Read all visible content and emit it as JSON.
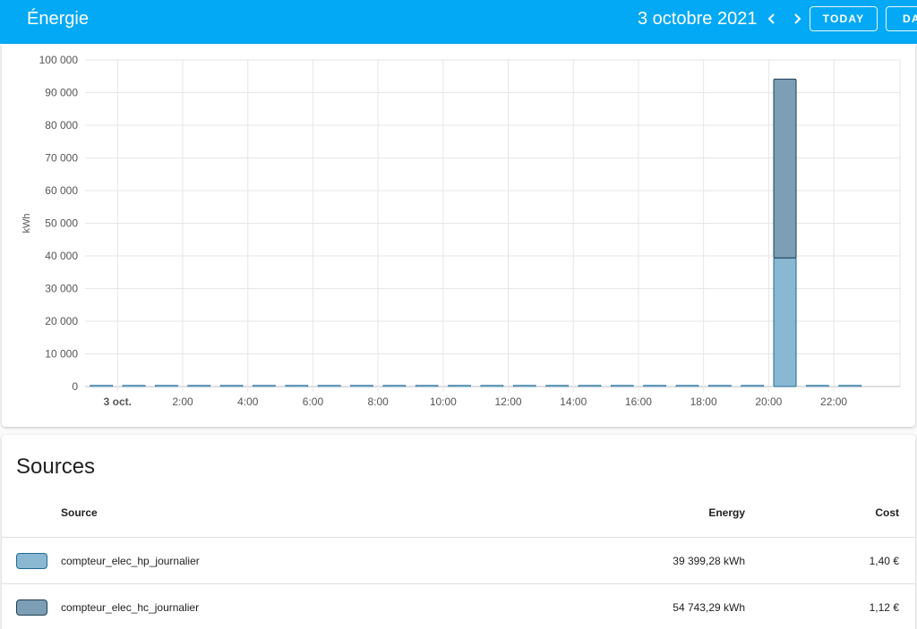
{
  "header": {
    "title": "Énergie",
    "date": "3 octobre 2021",
    "today_label": "TODAY",
    "day_label": "DAY"
  },
  "colors": {
    "header_bg": "#03a9f4",
    "hp_fill": "#8ab8d2",
    "hp_border": "#1e6a94",
    "hc_fill": "#7d9fb5",
    "hc_border": "#1d3e54"
  },
  "chart_data": {
    "type": "bar",
    "stacked": true,
    "ylabel": "kWh",
    "ylim": [
      0,
      100000
    ],
    "y_ticks": [
      0,
      10000,
      20000,
      30000,
      40000,
      50000,
      60000,
      70000,
      80000,
      90000,
      100000
    ],
    "y_tick_labels": [
      "0",
      "10 000",
      "20 000",
      "30 000",
      "40 000",
      "50 000",
      "60 000",
      "70 000",
      "80 000",
      "90 000",
      "100 000"
    ],
    "x_tick_labels": [
      "3 oct.",
      "2:00",
      "4:00",
      "6:00",
      "8:00",
      "10:00",
      "12:00",
      "14:00",
      "16:00",
      "18:00",
      "20:00",
      "22:00"
    ],
    "x_tick_hours": [
      0,
      2,
      4,
      6,
      8,
      10,
      12,
      14,
      16,
      18,
      20,
      22
    ],
    "hours": [
      0,
      1,
      2,
      3,
      4,
      5,
      6,
      7,
      8,
      9,
      10,
      11,
      12,
      13,
      14,
      15,
      16,
      17,
      18,
      19,
      20,
      21,
      22,
      23
    ],
    "series": [
      {
        "key": "hp",
        "values": [
          0,
          0,
          0,
          0,
          0,
          0,
          0,
          0,
          0,
          0,
          0,
          0,
          0,
          0,
          0,
          0,
          0,
          0,
          0,
          0,
          0,
          39399.28,
          0,
          0
        ]
      },
      {
        "key": "hc",
        "values": [
          0,
          0,
          0,
          0,
          0,
          0,
          0,
          0,
          0,
          0,
          0,
          0,
          0,
          0,
          0,
          0,
          0,
          0,
          0,
          0,
          0,
          54743.29,
          0,
          0
        ]
      }
    ],
    "grid": true
  },
  "sources": {
    "title": "Sources",
    "columns": {
      "source": "Source",
      "energy": "Energy",
      "cost": "Cost"
    },
    "rows": [
      {
        "name": "compteur_elec_hp_journalier",
        "energy": "39 399,28 kWh",
        "cost": "1,40 €"
      },
      {
        "name": "compteur_elec_hc_journalier",
        "energy": "54 743,29 kWh",
        "cost": "1,12 €"
      }
    ]
  }
}
